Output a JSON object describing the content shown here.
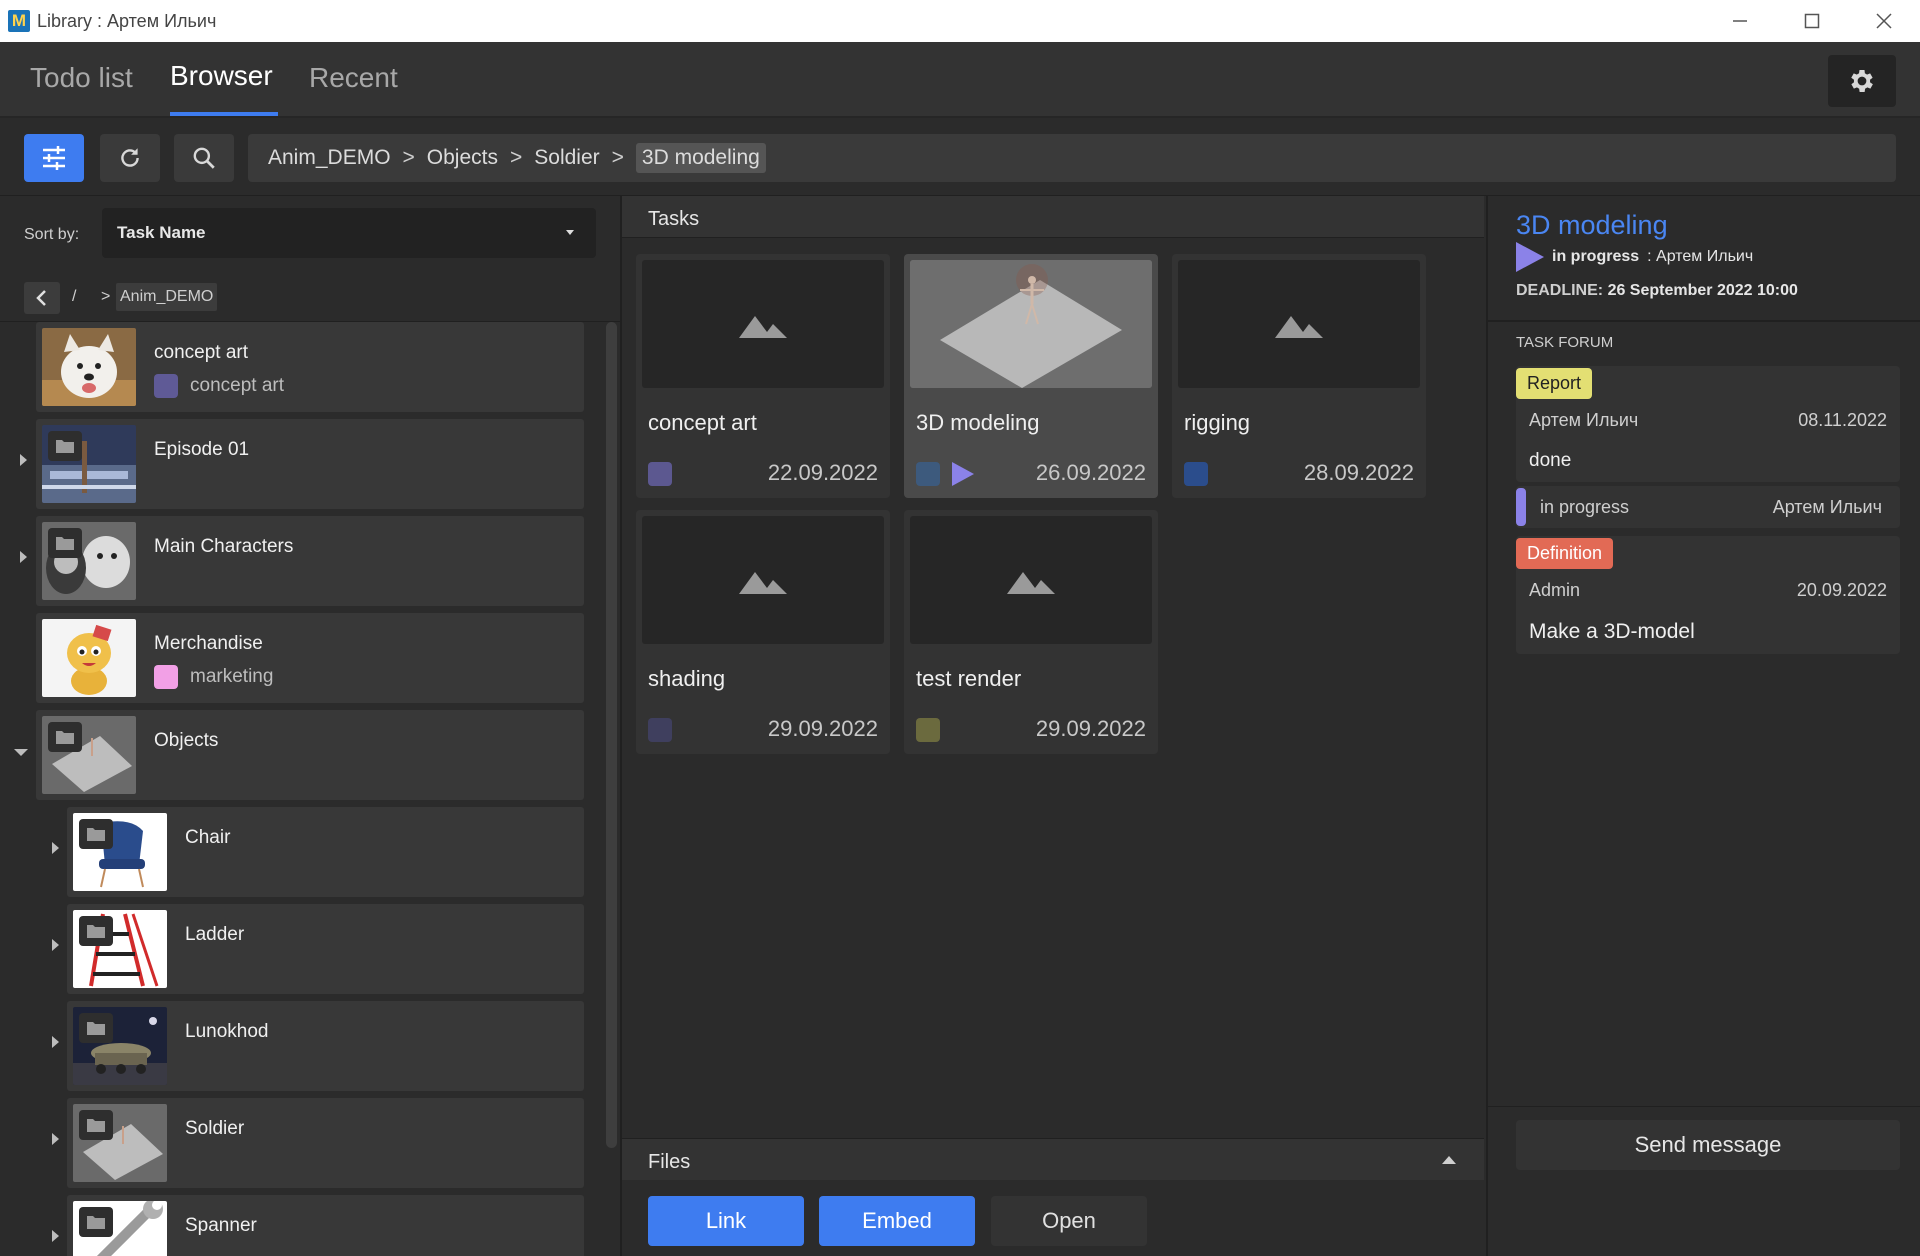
{
  "window": {
    "title": "Library : Артем Ильич",
    "logo_letter": "M"
  },
  "tabs": [
    {
      "label": "Todo list"
    },
    {
      "label": "Browser"
    },
    {
      "label": "Recent"
    }
  ],
  "breadcrumb": [
    "Anim_DEMO",
    "Objects",
    "Soldier",
    "3D modeling"
  ],
  "breadcrumb_sep": ">",
  "sort": {
    "label": "Sort by:",
    "value": "Task Name"
  },
  "nav": {
    "slash": "/",
    "gt": ">",
    "current": "Anim_DEMO"
  },
  "tree": [
    {
      "name": "concept art",
      "tag": "concept art",
      "tag_color": "#5f5a96",
      "thumb": "dog"
    },
    {
      "name": "Episode 01",
      "thumb": "episode"
    },
    {
      "name": "Main Characters",
      "thumb": "bw"
    },
    {
      "name": "Merchandise",
      "tag": "marketing",
      "tag_color": "#f2a0e6",
      "thumb": "cartoon"
    },
    {
      "name": "Objects",
      "thumb": "plane"
    },
    {
      "name": "Chair",
      "thumb": "chair"
    },
    {
      "name": "Ladder",
      "thumb": "ladder"
    },
    {
      "name": "Lunokhod",
      "thumb": "lunokhod"
    },
    {
      "name": "Soldier",
      "thumb": "plane"
    },
    {
      "name": "Spanner",
      "thumb": "spanner"
    }
  ],
  "tasks_header": "Tasks",
  "tasks": [
    {
      "name": "concept art",
      "date": "22.09.2022",
      "swatch": "#5c5890"
    },
    {
      "name": "3D modeling",
      "date": "26.09.2022",
      "swatch": "#3d5a7d",
      "selected": true
    },
    {
      "name": "rigging",
      "date": "28.09.2022",
      "swatch": "#2b4d8c"
    },
    {
      "name": "shading",
      "date": "29.09.2022",
      "swatch": "#3f3f5e"
    },
    {
      "name": "test render",
      "date": "29.09.2022",
      "swatch": "#6b6a3e"
    }
  ],
  "files_header": "Files",
  "actions": {
    "link": "Link",
    "embed": "Embed",
    "open": "Open"
  },
  "details": {
    "title": "3D modeling",
    "status": "in progress",
    "assignee": ": Артем Ильич",
    "deadline_label": "DEADLINE:",
    "deadline_value": "26 September 2022 10:00",
    "forum_label": "TASK FORUM",
    "messages": [
      {
        "tag": "Report",
        "author": "Артем Ильич",
        "date": "08.11.2022",
        "body": "done"
      },
      {
        "tag": "Definition",
        "author": "Admin",
        "date": "20.09.2022",
        "body": "Make a 3D-model"
      }
    ],
    "status_strip": {
      "status": "in progress",
      "user": "Артем Ильич"
    },
    "send_label": "Send message"
  },
  "colors": {
    "accent": "#3e7cf0",
    "status_in_progress": "#8b82e8"
  }
}
